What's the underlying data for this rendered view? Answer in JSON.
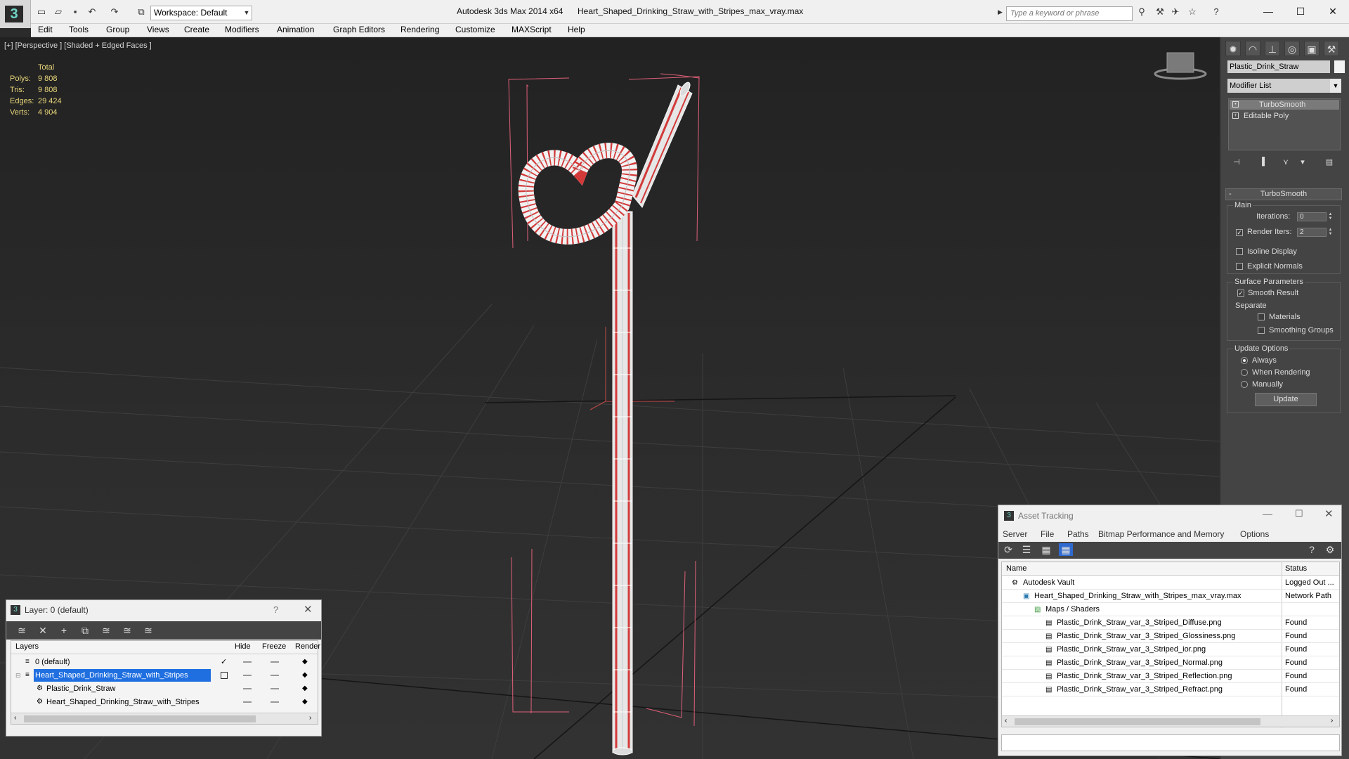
{
  "title_bar": {
    "app_title": "Autodesk 3ds Max  2014 x64",
    "document_title": "Heart_Shaped_Drinking_Straw_with_Stripes_max_vray.max",
    "workspace": "Workspace: Default",
    "search_placeholder": "Type a keyword or phrase"
  },
  "menu": [
    "Edit",
    "Tools",
    "Group",
    "Views",
    "Create",
    "Modifiers",
    "Animation",
    "Graph Editors",
    "Rendering",
    "Customize",
    "MAXScript",
    "Help"
  ],
  "viewport": {
    "label": "[+] [Perspective ] [Shaded + Edged Faces ]",
    "stats": {
      "header": "Total",
      "rows": [
        {
          "label": "Polys:",
          "value": "9 808"
        },
        {
          "label": "Tris:",
          "value": "9 808"
        },
        {
          "label": "Edges:",
          "value": "29 424"
        },
        {
          "label": "Verts:",
          "value": "4 904"
        }
      ]
    }
  },
  "command_panel": {
    "object_name": "Plastic_Drink_Straw",
    "modifier_list": "Modifier List",
    "stack": [
      "TurboSmooth",
      "Editable Poly"
    ],
    "rollout": "TurboSmooth",
    "main_group": "Main",
    "iterations_label": "Iterations:",
    "iterations_value": "0",
    "render_iters_label": "Render Iters:",
    "render_iters_value": "2",
    "isoline_display": "Isoline Display",
    "explicit_normals": "Explicit Normals",
    "surface_parameters": "Surface Parameters",
    "smooth_result": "Smooth Result",
    "separate": "Separate",
    "materials": "Materials",
    "smoothing_groups": "Smoothing Groups",
    "update_options": "Update Options",
    "always": "Always",
    "when_rendering": "When Rendering",
    "manually": "Manually",
    "update_button": "Update"
  },
  "layer_dialog": {
    "title": "Layer: 0 (default)",
    "help": "?",
    "columns": [
      "Layers",
      "Hide",
      "Freeze",
      "Render"
    ],
    "rows": [
      {
        "name": "0 (default)",
        "indent": 1
      },
      {
        "name": "Heart_Shaped_Drinking_Straw_with_Stripes",
        "indent": 1
      },
      {
        "name": "Plastic_Drink_Straw",
        "indent": 2
      },
      {
        "name": "Heart_Shaped_Drinking_Straw_with_Stripes",
        "indent": 2
      }
    ]
  },
  "asset_tracking": {
    "title": "Asset Tracking",
    "menu": [
      "Server",
      "File",
      "Paths",
      "Bitmap Performance and Memory",
      "Options"
    ],
    "columns": [
      "Name",
      "Status"
    ],
    "rows": [
      {
        "name": "Autodesk Vault",
        "status": "Logged Out ..."
      },
      {
        "name": "Heart_Shaped_Drinking_Straw_with_Stripes_max_vray.max",
        "status": "Network Path"
      },
      {
        "name": "Maps / Shaders",
        "status": ""
      },
      {
        "name": "Plastic_Drink_Straw_var_3_Striped_Diffuse.png",
        "status": "Found"
      },
      {
        "name": "Plastic_Drink_Straw_var_3_Striped_Glossiness.png",
        "status": "Found"
      },
      {
        "name": "Plastic_Drink_Straw_var_3_Striped_ior.png",
        "status": "Found"
      },
      {
        "name": "Plastic_Drink_Straw_var_3_Striped_Normal.png",
        "status": "Found"
      },
      {
        "name": "Plastic_Drink_Straw_var_3_Striped_Reflection.png",
        "status": "Found"
      },
      {
        "name": "Plastic_Drink_Straw_var_3_Striped_Refract.png",
        "status": "Found"
      }
    ]
  },
  "colors": {
    "accent_selection": "#1f6fe0",
    "stats_text": "#e8d67a",
    "bbox_lines": "#e0607a",
    "straw_stripe": "#d23a3a"
  }
}
